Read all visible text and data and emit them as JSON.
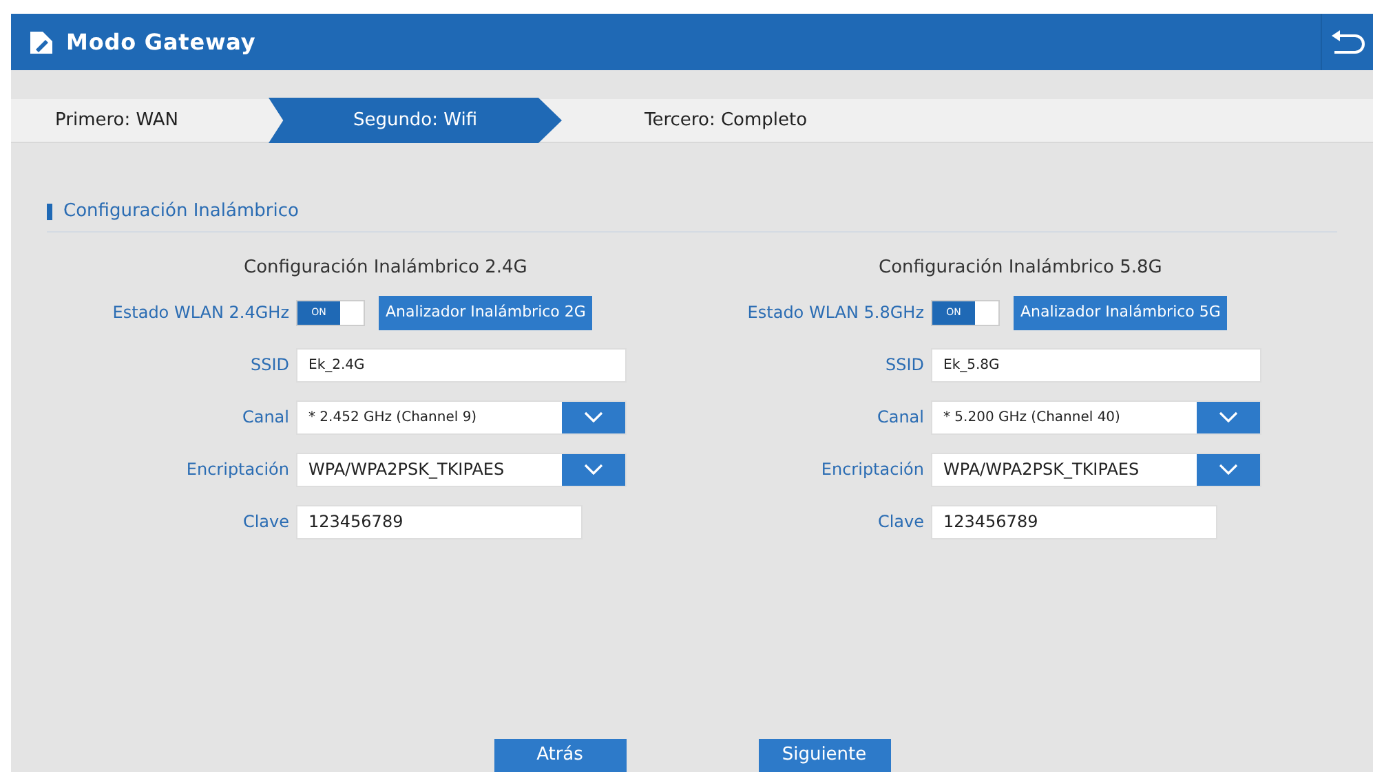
{
  "header": {
    "title": "Modo Gateway"
  },
  "steps": [
    {
      "label": "Primero: WAN",
      "selected": false
    },
    {
      "label": "Segundo: Wifi",
      "selected": true
    },
    {
      "label": "Tercero: Completo",
      "selected": false
    }
  ],
  "section": {
    "title": "Configuración Inalámbrico"
  },
  "panels": [
    {
      "title": "Configuración Inalámbrico 2.4G",
      "wlan_label": "Estado WLAN 2.4GHz",
      "wlan_on": true,
      "wlan_toggle_text": "ON",
      "analyzer_button": "Analizador Inalámbrico 2G",
      "ssid_label": "SSID",
      "ssid": "Ek_2.4G",
      "channel_label": "Canal",
      "channel": "* 2.452 GHz (Channel 9)",
      "encryption_label": "Encriptación",
      "encryption": "WPA/WPA2PSK_TKIPAES",
      "key_label": "Clave",
      "key": "123456789"
    },
    {
      "title": "Configuración Inalámbrico 5.8G",
      "wlan_label": "Estado WLAN 5.8GHz",
      "wlan_on": true,
      "wlan_toggle_text": "ON",
      "analyzer_button": "Analizador Inalámbrico 5G",
      "ssid_label": "SSID",
      "ssid": "Ek_5.8G",
      "channel_label": "Canal",
      "channel": "* 5.200 GHz (Channel 40)",
      "encryption_label": "Encriptación",
      "encryption": "WPA/WPA2PSK_TKIPAES",
      "key_label": "Clave",
      "key": "123456789"
    }
  ],
  "buttons": [
    "Atrás",
    "Siguiente"
  ]
}
